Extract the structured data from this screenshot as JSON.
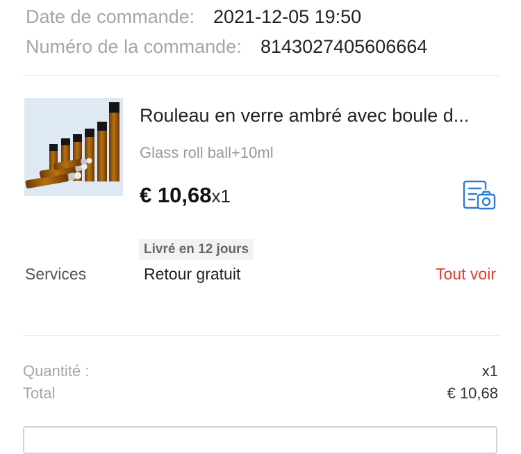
{
  "order": {
    "date_label": "Date de commande:",
    "date_value": "2021-12-05 19:50",
    "number_label": "Numéro de la commande:",
    "number_value": "8143027405606664"
  },
  "product": {
    "title": "Rouleau en verre ambré avec boule d...",
    "variant": "Glass roll ball+10ml",
    "price": "€ 10,68",
    "quantity_inline": "x1",
    "delivery_badge": "Livré en 12 jours",
    "snapshot_icon": "document-camera-icon"
  },
  "services": {
    "label": "Services",
    "value": "Retour gratuit",
    "see_all": "Tout voir"
  },
  "summary": {
    "quantity_label": "Quantité :",
    "quantity_value": "x1",
    "total_label": "Total",
    "total_value": "€ 10,68"
  },
  "colors": {
    "accent_red": "#e0402c",
    "icon_blue": "#2f7bd6",
    "muted_text": "#a6a6a6"
  }
}
